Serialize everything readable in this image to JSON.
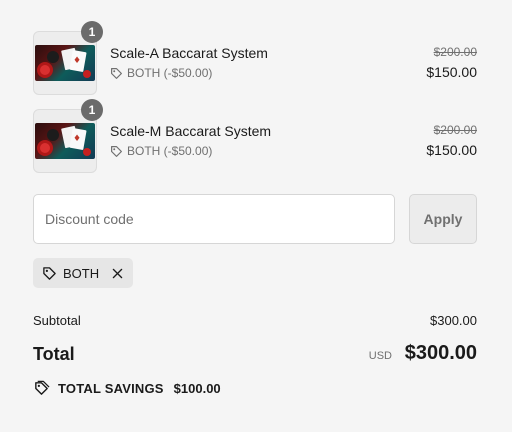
{
  "line_items": [
    {
      "quantity": "1",
      "name": "Scale-A Baccarat System",
      "discount": "BOTH (-$50.00)",
      "original_price": "$200.00",
      "price": "$150.00"
    },
    {
      "quantity": "1",
      "name": "Scale-M Baccarat System",
      "discount": "BOTH (-$50.00)",
      "original_price": "$200.00",
      "price": "$150.00"
    }
  ],
  "discount": {
    "placeholder": "Discount code",
    "value": "",
    "apply_label": "Apply",
    "applied_code": "BOTH"
  },
  "summary": {
    "subtotal_label": "Subtotal",
    "subtotal_value": "$300.00",
    "total_label": "Total",
    "currency": "USD",
    "total_value": "$300.00",
    "savings_label": "TOTAL SAVINGS",
    "savings_value": "$100.00"
  },
  "icons": {
    "tag": "tag-icon",
    "close": "close-icon",
    "savings_tag": "price-tag-icon"
  },
  "colors": {
    "background": "#f5f5f5",
    "badge": "#6b6b6b",
    "muted_text": "#707070",
    "chip": "#e6e6e6"
  }
}
